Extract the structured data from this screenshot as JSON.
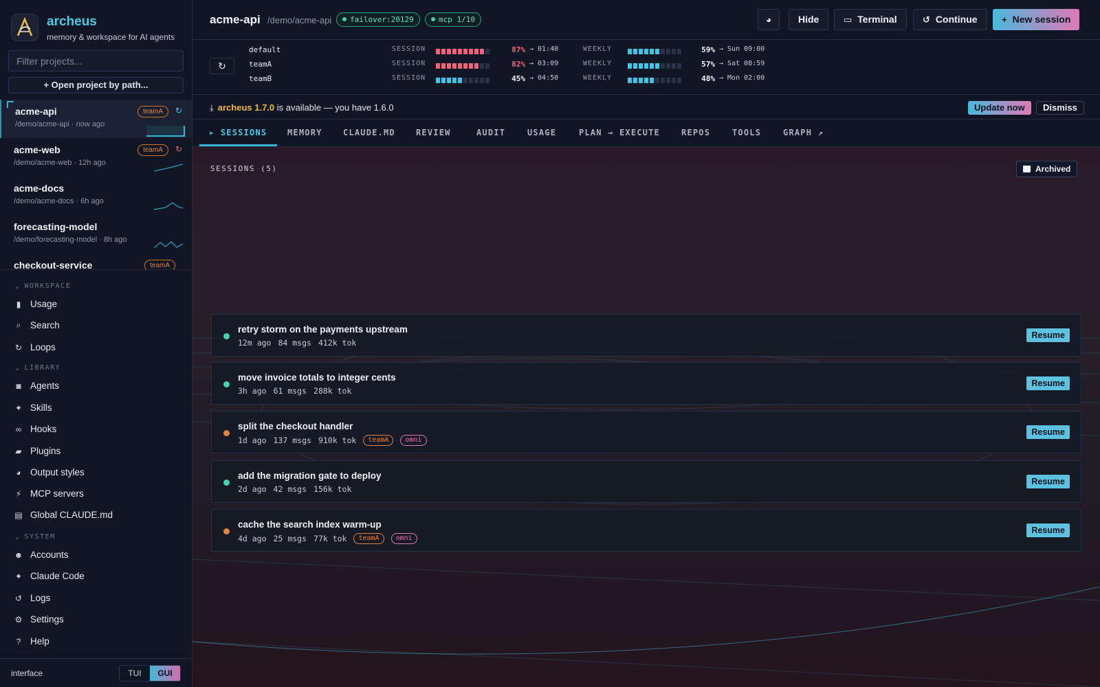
{
  "brand": {
    "name": "archeus",
    "subtitle": "memory & workspace for AI agents"
  },
  "sidebar": {
    "filter_placeholder": "Filter projects...",
    "open_path_label": "+ Open project by path...",
    "projects": [
      {
        "name": "acme-api",
        "path": "/demo/acme-api · now ago",
        "tag": "teamA",
        "refresh": "↻"
      },
      {
        "name": "acme-web",
        "path": "/demo/acme-web · 12h ago",
        "tag": "teamA",
        "refresh": "↻"
      },
      {
        "name": "acme-docs",
        "path": "/demo/acme-docs · 6h ago"
      },
      {
        "name": "forecasting-model",
        "path": "/demo/forecasting-model · 8h ago"
      },
      {
        "name": "checkout-service",
        "tag": "teamA"
      }
    ],
    "sections": {
      "workspace": "WORKSPACE",
      "library": "LIBRARY",
      "system": "SYSTEM"
    },
    "workspace_items": [
      "Usage",
      "Search",
      "Loops"
    ],
    "library_items": [
      "Agents",
      "Skills",
      "Hooks",
      "Plugins",
      "Output styles",
      "MCP servers",
      "Global CLAUDE.md"
    ],
    "system_items": [
      "Accounts",
      "Claude Code",
      "Logs",
      "Settings",
      "Help"
    ],
    "interface": {
      "label": "interface",
      "tui": "TUI",
      "gui": "GUI",
      "selected": "GUI"
    }
  },
  "header": {
    "title": "acme-api",
    "path": "/demo/acme-api",
    "pills": [
      "failover:20129",
      "mcp 1/10"
    ],
    "buttons": {
      "hide": "Hide",
      "terminal": "Terminal",
      "continue": "Continue",
      "new_session": "New session"
    }
  },
  "usage": {
    "session_label": "SESSION",
    "weekly_label": "WEEKLY",
    "accounts": [
      {
        "name": "default",
        "session_pct": 87,
        "session_pct_label": "87%",
        "session_reset": "→ 01:40",
        "weekly_pct": 59,
        "weekly_pct_label": "59%",
        "weekly_reset": "→ Sun 09:00"
      },
      {
        "name": "teamA",
        "session_pct": 82,
        "session_pct_label": "82%",
        "session_reset": "→ 03:09",
        "weekly_pct": 57,
        "weekly_pct_label": "57%",
        "weekly_reset": "→ Sat 08:59"
      },
      {
        "name": "teamB",
        "session_pct": 45,
        "session_pct_label": "45%",
        "session_reset": "→ 04:50",
        "weekly_pct": 48,
        "weekly_pct_label": "48%",
        "weekly_reset": "→ Mon 02:00"
      }
    ]
  },
  "update": {
    "version": "archeus 1.7.0",
    "text": "is available — you have 1.6.0",
    "update_now": "Update now",
    "dismiss": "Dismiss"
  },
  "tabs": [
    "▸ SESSIONS",
    "MEMORY",
    "CLAUDE.MD",
    "REVIEW",
    "AUDIT",
    "USAGE",
    "PLAN → EXECUTE",
    "REPOS",
    "TOOLS",
    "GRAPH"
  ],
  "sessions": {
    "heading": "SESSIONS (5)",
    "archived_label": "Archived",
    "resume_label": "Resume",
    "items": [
      {
        "title": "retry storm on the payments upstream",
        "age": "12m ago",
        "msgs": "84 msgs",
        "tok": "412k tok",
        "status": "green",
        "tags": []
      },
      {
        "title": "move invoice totals to integer cents",
        "age": "3h ago",
        "msgs": "61 msgs",
        "tok": "288k tok",
        "status": "green",
        "tags": []
      },
      {
        "title": "split the checkout handler",
        "age": "1d ago",
        "msgs": "137 msgs",
        "tok": "910k tok",
        "status": "orange",
        "tags": [
          "teamA",
          "omni"
        ]
      },
      {
        "title": "add the migration gate to deploy",
        "age": "2d ago",
        "msgs": "42 msgs",
        "tok": "156k tok",
        "status": "green",
        "tags": []
      },
      {
        "title": "cache the search index warm-up",
        "age": "4d ago",
        "msgs": "25 msgs",
        "tok": "77k tok",
        "status": "orange",
        "tags": [
          "teamA",
          "omni"
        ]
      }
    ]
  },
  "colors": {
    "accent": "#4ec9e8",
    "pink": "#e078b6",
    "orange": "#e6823a",
    "green": "#40d7a8",
    "red": "#f0637a"
  }
}
